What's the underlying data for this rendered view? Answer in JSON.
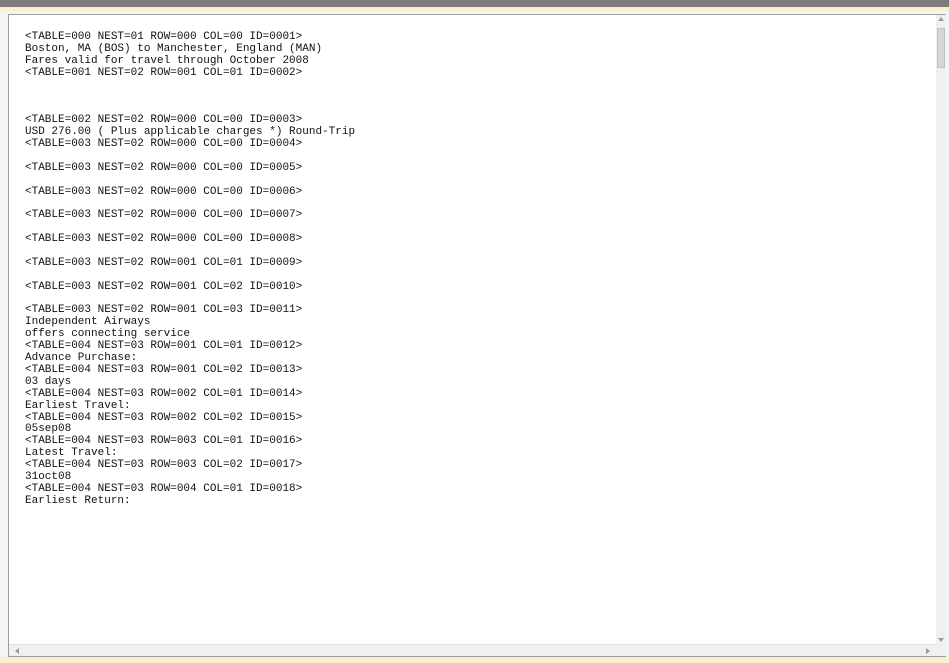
{
  "editor": {
    "lines": [
      "<TABLE=000 NEST=01 ROW=000 COL=00 ID=0001>",
      "Boston, MA (BOS) to Manchester, England (MAN)",
      "Fares valid for travel through October 2008",
      "<TABLE=001 NEST=02 ROW=001 COL=01 ID=0002>",
      "",
      "",
      "",
      "<TABLE=002 NEST=02 ROW=000 COL=00 ID=0003>",
      "USD 276.00 ( Plus applicable charges *) Round-Trip",
      "<TABLE=003 NEST=02 ROW=000 COL=00 ID=0004>",
      "",
      "<TABLE=003 NEST=02 ROW=000 COL=00 ID=0005>",
      "",
      "<TABLE=003 NEST=02 ROW=000 COL=00 ID=0006>",
      "",
      "<TABLE=003 NEST=02 ROW=000 COL=00 ID=0007>",
      "",
      "<TABLE=003 NEST=02 ROW=000 COL=00 ID=0008>",
      "",
      "<TABLE=003 NEST=02 ROW=001 COL=01 ID=0009>",
      "",
      "<TABLE=003 NEST=02 ROW=001 COL=02 ID=0010>",
      "",
      "<TABLE=003 NEST=02 ROW=001 COL=03 ID=0011>",
      "Independent Airways",
      "offers connecting service",
      "<TABLE=004 NEST=03 ROW=001 COL=01 ID=0012>",
      "Advance Purchase:",
      "<TABLE=004 NEST=03 ROW=001 COL=02 ID=0013>",
      "03 days",
      "<TABLE=004 NEST=03 ROW=002 COL=01 ID=0014>",
      "Earliest Travel:",
      "<TABLE=004 NEST=03 ROW=002 COL=02 ID=0015>",
      "05sep08",
      "<TABLE=004 NEST=03 ROW=003 COL=01 ID=0016>",
      "Latest Travel:",
      "<TABLE=004 NEST=03 ROW=003 COL=02 ID=0017>",
      "31oct08",
      "<TABLE=004 NEST=03 ROW=004 COL=01 ID=0018>",
      "Earliest Return:"
    ]
  }
}
